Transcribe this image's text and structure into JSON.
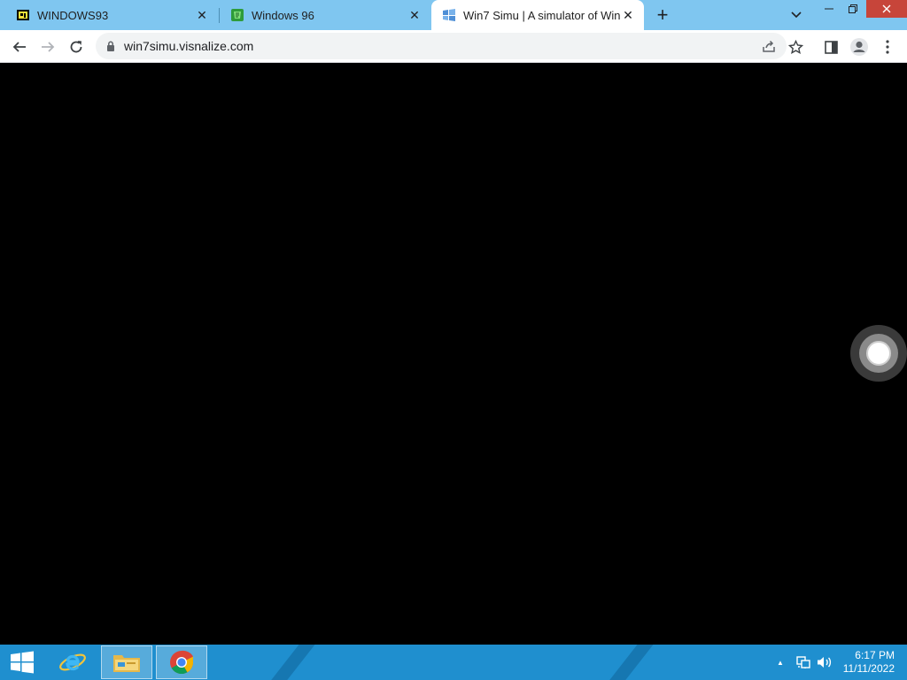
{
  "browser": {
    "tabs": [
      {
        "title": "WINDOWS93",
        "favicon": "windows93-icon",
        "active": false
      },
      {
        "title": "Windows 96",
        "favicon": "windows96-icon",
        "active": false
      },
      {
        "title": "Win7 Simu | A simulator of Wind",
        "favicon": "win7simu-icon",
        "active": true
      }
    ],
    "close_glyph": "✕",
    "new_tab_glyph": "+",
    "url": "win7simu.visnalize.com"
  },
  "taskbar": {
    "clock_time": "6:17 PM",
    "clock_date": "11/11/2022",
    "tray_up_glyph": "▲"
  },
  "colors": {
    "tabstrip": "#7fc6f0",
    "taskbar": "#1f8fcf",
    "content": "#000000"
  }
}
